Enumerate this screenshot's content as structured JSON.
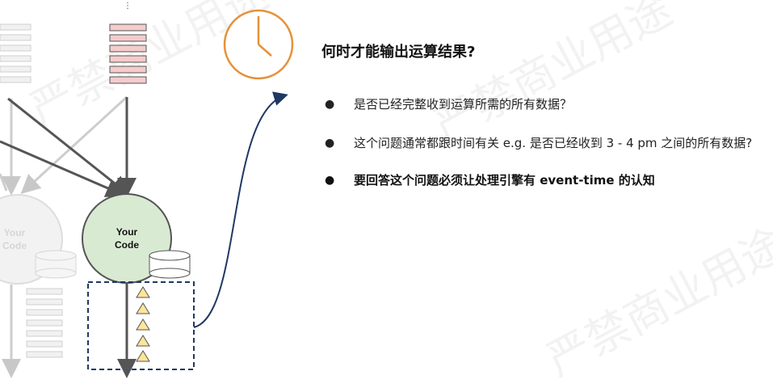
{
  "heading": "何时才能输出运算结果?",
  "bullets": [
    "是否已经完整收到运算所需的所有数据？",
    "这个问题通常都跟时间有关 e.g. 是否已经收到 3 - 4 pm 之间的所有数据?",
    "要回答这个问题必须让处理引擎有 event-time 的认知"
  ],
  "diagram": {
    "operators": [
      {
        "label_line1": "Your",
        "label_line2": "Code",
        "state": "faded"
      },
      {
        "label_line1": "Your",
        "label_line2": "Code",
        "state": "active"
      }
    ],
    "clock_icon": "clock-icon",
    "watermark_marker_icon": "triangle-icon",
    "colors": {
      "active_operator_fill": "#d9ead3",
      "input_buffer_fill": "#f4cccc",
      "clock_stroke": "#e69138",
      "arrow_blue": "#1f3864",
      "triangle_fill": "#ffe599"
    }
  },
  "watermark": [
    "严禁商业用途",
    "严禁商业用途",
    "严禁商业用途"
  ]
}
